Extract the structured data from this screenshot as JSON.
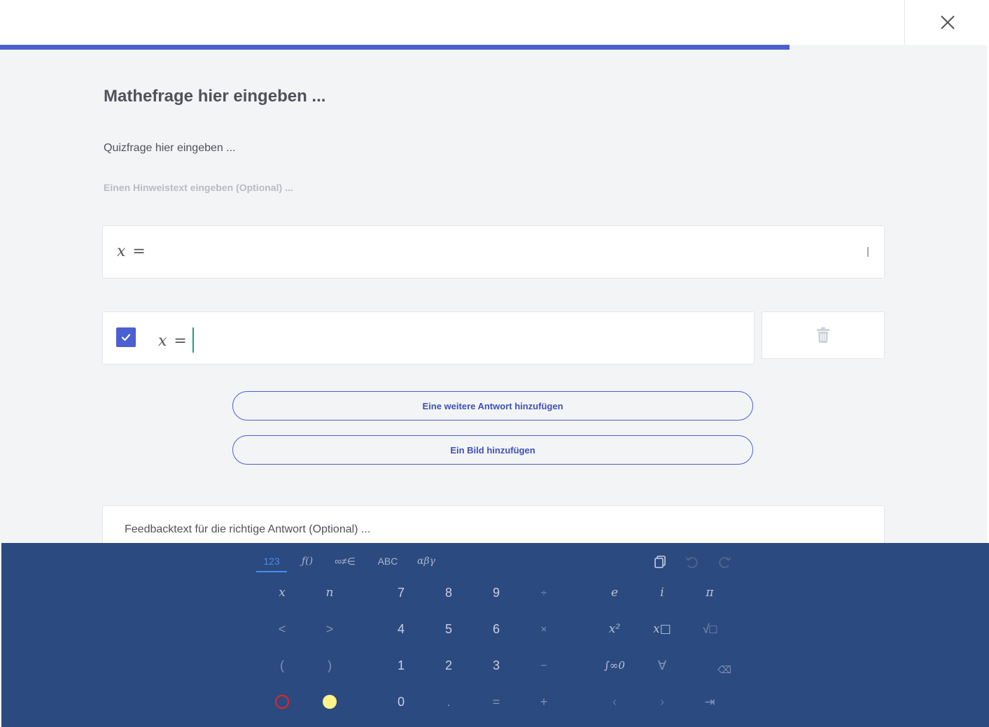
{
  "header": {
    "progress_percent": 80,
    "close_icon": "close-icon"
  },
  "question": {
    "math_title": "Mathefrage hier eingeben ...",
    "quiz_question": "Quizfrage hier eingeben ...",
    "hint_placeholder": "Einen Hinweistext eingeben (Optional) ..."
  },
  "formula": {
    "variable": "x",
    "equals": "="
  },
  "answer": {
    "checked": true,
    "variable": "x",
    "equals": "=",
    "delete_icon": "trash-icon"
  },
  "buttons": {
    "add_answer": "Eine weitere Antwort hinzufügen",
    "add_image": "Ein Bild hinzufügen"
  },
  "feedback": {
    "placeholder": "Feedbacktext für die richtige Antwort (Optional) ..."
  },
  "keyboard": {
    "tabs": [
      "123",
      "ƒ()",
      "∞≠∈",
      "ABC",
      "αβγ"
    ],
    "active_tab": "123",
    "tools": [
      "copy-icon",
      "undo-icon",
      "redo-icon"
    ],
    "rows": [
      [
        "x",
        "n",
        "7",
        "8",
        "9",
        "÷",
        "e",
        "i",
        "π"
      ],
      [
        "<",
        ">",
        "4",
        "5",
        "6",
        "×",
        "x²",
        "x□",
        "√□"
      ],
      [
        "(",
        ")",
        "1",
        "2",
        "3",
        "−",
        "∫∞0",
        "∀",
        "⌫"
      ],
      [
        "○",
        "●",
        "0",
        ".",
        "=",
        "+",
        "‹",
        "›",
        "⇥"
      ]
    ],
    "colors": {
      "red_circle": "#d8262f",
      "yellow_circle": "#fff389",
      "background": "#2b4a7f",
      "accent": "#4a5fd1"
    }
  }
}
